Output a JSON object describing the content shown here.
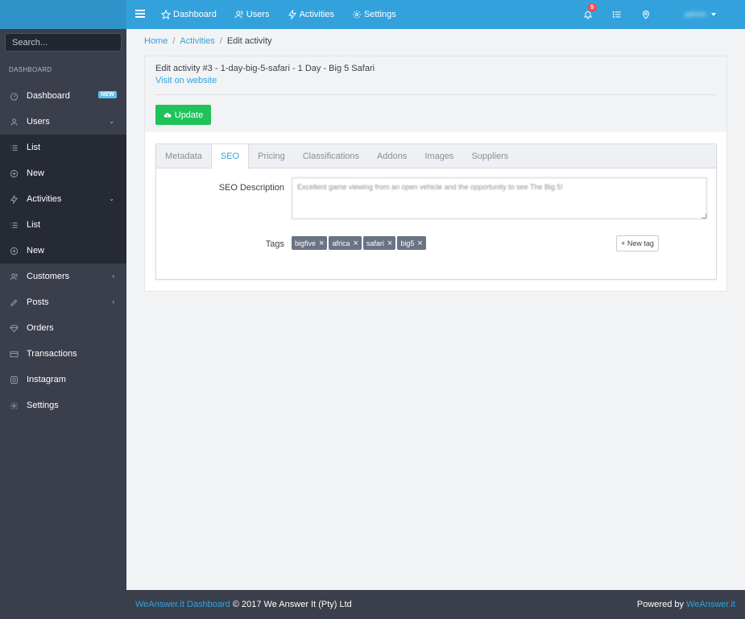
{
  "topnav": {
    "items": [
      {
        "label": "Dashboard",
        "icon": "star-icon"
      },
      {
        "label": "Users",
        "icon": "users-icon"
      },
      {
        "label": "Activities",
        "icon": "bolt-icon"
      },
      {
        "label": "Settings",
        "icon": "gear-icon"
      }
    ],
    "notifications_count": "5",
    "user_name": "admin"
  },
  "sidebar": {
    "search_placeholder": "Search...",
    "section_title": "DASHBOARD",
    "items": [
      {
        "label": "Dashboard",
        "icon": "speedometer-icon",
        "badge": "NEW"
      },
      {
        "label": "Users",
        "icon": "user-icon"
      },
      {
        "label": "List",
        "icon": "list-icon"
      },
      {
        "label": "New",
        "icon": "plus-circle-icon"
      },
      {
        "label": "Activities",
        "icon": "bolt-icon"
      },
      {
        "label": "List",
        "icon": "list-icon"
      },
      {
        "label": "New",
        "icon": "plus-circle-icon"
      },
      {
        "label": "Customers",
        "icon": "users-icon"
      },
      {
        "label": "Posts",
        "icon": "pencil-icon"
      },
      {
        "label": "Orders",
        "icon": "diamond-icon"
      },
      {
        "label": "Transactions",
        "icon": "credit-card-icon"
      },
      {
        "label": "Instagram",
        "icon": "instagram-icon"
      },
      {
        "label": "Settings",
        "icon": "gear-icon"
      }
    ]
  },
  "breadcrumb": {
    "home": "Home",
    "activities": "Activities",
    "current": "Edit activity"
  },
  "card": {
    "title": "Edit activity #3 - 1-day-big-5-safari - 1 Day - Big 5 Safari",
    "visit_link": "Visit on website",
    "update_label": "Update"
  },
  "tabs": [
    "Metadata",
    "SEO",
    "Pricing",
    "Classifications",
    "Addons",
    "Images",
    "Suppliers"
  ],
  "active_tab": "SEO",
  "seo": {
    "description_label": "SEO Description",
    "description_value": "Excellent game viewing from an open vehicle and the opportunity to see The Big 5!",
    "tags_label": "Tags",
    "tags": [
      "bigfive",
      "africa",
      "safari",
      "big5"
    ],
    "new_tag_label": "+ New tag"
  },
  "footer": {
    "brand_link": "WeAnswer.it Dashboard",
    "copyright": " © 2017 We Answer It (Pty) Ltd",
    "powered_by": "Powered by ",
    "powered_link": "WeAnswer.it"
  },
  "colors": {
    "primary": "#33a2dc",
    "sidebar": "#3b3f4b",
    "success": "#1fc25b",
    "badge_red": "#f04b5a"
  }
}
